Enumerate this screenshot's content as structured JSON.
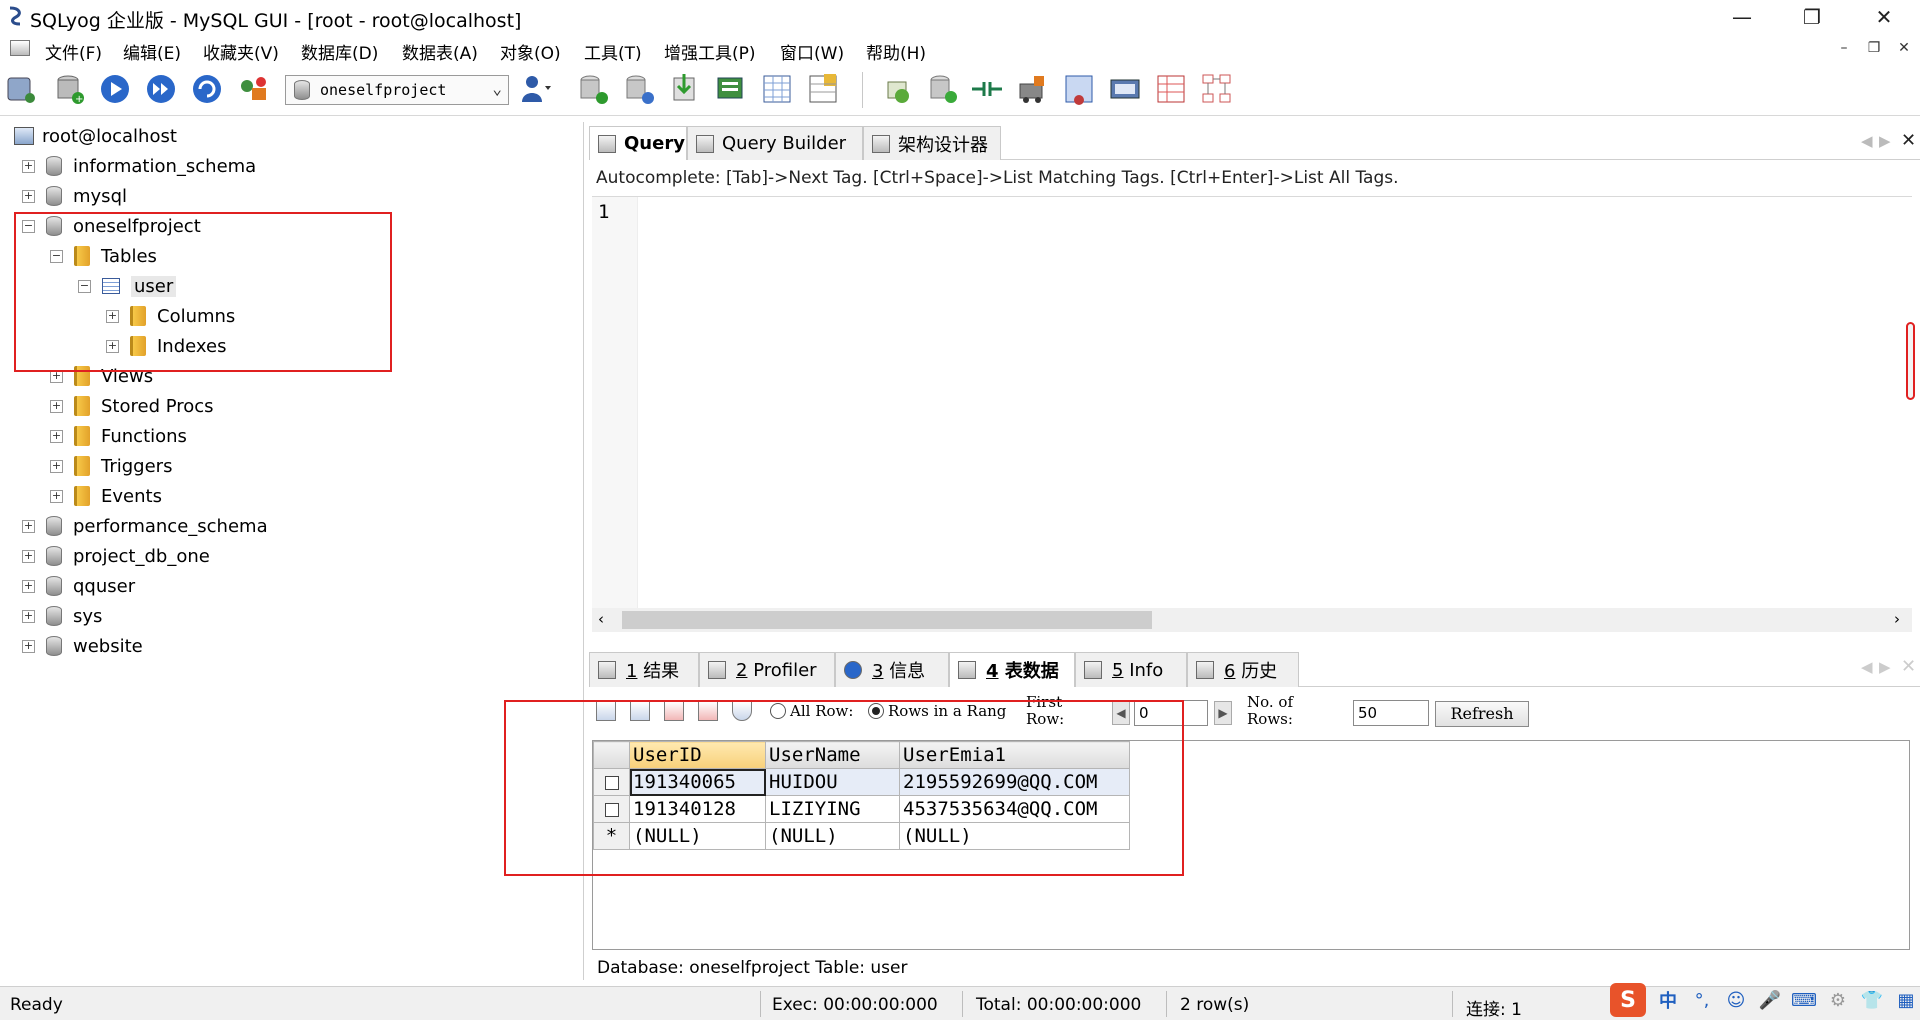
{
  "window": {
    "title": "SQLyog 企业版 - MySQL GUI - [root - root@localhost]",
    "controls": {
      "minimize": "—",
      "restore": "❐",
      "close": "✕"
    }
  },
  "menu": {
    "items": [
      "文件(F)",
      "编辑(E)",
      "收藏夹(V)",
      "数据库(D)",
      "数据表(A)",
      "对象(O)",
      "工具(T)",
      "增强工具(P)",
      "窗口(W)",
      "帮助(H)"
    ],
    "mdi_controls": [
      "–",
      "❐",
      "✕"
    ]
  },
  "toolbar": {
    "database_selector": "oneselfproject"
  },
  "object_browser": {
    "connection": "root@localhost",
    "databases": {
      "information_schema": "information_schema",
      "mysql": "mysql",
      "oneselfproject": "oneselfproject",
      "performance_schema": "performance_schema",
      "project_db_one": "project_db_one",
      "qquser": "qquser",
      "sys": "sys",
      "website": "website"
    },
    "folders": {
      "tables": "Tables",
      "views": "Views",
      "stored_procs": "Stored Procs",
      "functions": "Functions",
      "triggers": "Triggers",
      "events": "Events",
      "columns": "Columns",
      "indexes": "Indexes"
    },
    "table_user": "user"
  },
  "query_tabs": [
    "Query",
    "Query Builder",
    "架构设计器"
  ],
  "autocomplete_hint": "Autocomplete: [Tab]->Next Tag. [Ctrl+Space]->List Matching Tags. [Ctrl+Enter]->List All Tags.",
  "editor": {
    "line_number": "1"
  },
  "result_tabs": [
    {
      "num": "1",
      "label": "结果"
    },
    {
      "num": "2",
      "label": "Profiler"
    },
    {
      "num": "3",
      "label": "信息"
    },
    {
      "num": "4",
      "label": "表数据"
    },
    {
      "num": "5",
      "label": "Info"
    },
    {
      "num": "6",
      "label": "历史"
    }
  ],
  "grid_toolbar": {
    "all_rows": "All Row:",
    "rows_in_range": "Rows in a Rang",
    "first_row_label": "First Row:",
    "first_row_value": "0",
    "num_rows_label": "No. of Rows:",
    "num_rows_value": "50",
    "refresh": "Refresh"
  },
  "grid": {
    "columns": [
      "UserID",
      "UserName",
      "UserEmia1"
    ],
    "rows": [
      [
        "191340065",
        "HUIDOU",
        "2195592699@QQ.COM"
      ],
      [
        "191340128",
        "LIZIYING",
        "4537535634@QQ.COM"
      ],
      [
        "(NULL)",
        "(NULL)",
        "(NULL)"
      ]
    ],
    "new_row_marker": "*"
  },
  "db_info": "Database: oneselfproject Table: user",
  "status": {
    "ready": "Ready",
    "exec": "Exec: 00:00:00:000",
    "total": "Total: 00:00:00:000",
    "rows": "2 row(s)",
    "connections": "连接: 1"
  },
  "ime_tray": [
    "S",
    "中",
    "°,",
    "☺",
    "🎤",
    "⌨",
    "⚙",
    "👕",
    "▦"
  ],
  "colors": {
    "highlight_box": "#e02020",
    "sorted_header": "#f7d07a"
  }
}
